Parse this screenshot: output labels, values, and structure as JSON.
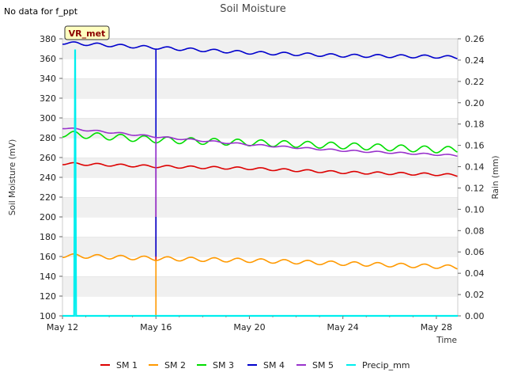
{
  "chart_data": {
    "type": "line",
    "title": "Soil Moisture",
    "no_data_note": "No data for f_ppt",
    "badge": "VR_met",
    "xlabel": "Time",
    "ylabel_left": "Soil Moisture (mV)",
    "ylabel_right": "Rain (mm)",
    "x_range": [
      "2023-05-12",
      "2023-05-28T22:00"
    ],
    "x_ticks": [
      "May 12",
      "May 16",
      "May 20",
      "May 24",
      "May 28"
    ],
    "y_left_range": [
      100,
      380
    ],
    "y_left_ticks": [
      "100",
      "120",
      "140",
      "160",
      "180",
      "200",
      "220",
      "240",
      "260",
      "280",
      "300",
      "320",
      "340",
      "360",
      "380"
    ],
    "y_right_range": [
      0.0,
      0.26
    ],
    "y_right_ticks": [
      "0.00",
      "0.02",
      "0.04",
      "0.06",
      "0.08",
      "0.10",
      "0.12",
      "0.14",
      "0.16",
      "0.18",
      "0.20",
      "0.22",
      "0.24",
      "0.26"
    ],
    "grid": "horizontal bands",
    "legend_position": "bottom",
    "series": [
      {
        "name": "SM 1",
        "color": "#dd0000",
        "axis": "left",
        "diurnal_amplitude": 1.2,
        "points": [
          [
            "May 12",
            254
          ],
          [
            "May 16",
            251
          ],
          [
            "May 20",
            249
          ],
          [
            "May 24",
            245
          ],
          [
            "May 28",
            243
          ],
          [
            "May 28 22:00",
            242
          ]
        ],
        "dropout": {
          "date": "May 16",
          "to": 155
        }
      },
      {
        "name": "SM 2",
        "color": "#ff9900",
        "axis": "left",
        "diurnal_amplitude": 2.0,
        "points": [
          [
            "May 12",
            161
          ],
          [
            "May 16",
            158
          ],
          [
            "May 20",
            156
          ],
          [
            "May 24",
            153
          ],
          [
            "May 28",
            150
          ],
          [
            "May 28 22:00",
            149
          ]
        ],
        "dropout": {
          "date": "May 16",
          "to": 100
        }
      },
      {
        "name": "SM 3",
        "color": "#00dd00",
        "axis": "left",
        "diurnal_amplitude": 3.2,
        "points": [
          [
            "May 12",
            284
          ],
          [
            "May 16",
            278
          ],
          [
            "May 20",
            275
          ],
          [
            "May 24",
            272
          ],
          [
            "May 28",
            268
          ],
          [
            "May 28 22:00",
            268
          ]
        ]
      },
      {
        "name": "SM 4",
        "color": "#0000cc",
        "axis": "left",
        "diurnal_amplitude": 1.5,
        "points": [
          [
            "May 12",
            376
          ],
          [
            "May 16",
            371
          ],
          [
            "May 20",
            366
          ],
          [
            "May 24",
            363
          ],
          [
            "May 28",
            362
          ],
          [
            "May 28 22:00",
            361
          ]
        ],
        "dropout": {
          "date": "May 16",
          "to": 160
        }
      },
      {
        "name": "SM 5",
        "color": "#9933cc",
        "axis": "left",
        "diurnal_amplitude": 0.8,
        "points": [
          [
            "May 12",
            290
          ],
          [
            "May 16",
            281
          ],
          [
            "May 20",
            273
          ],
          [
            "May 24",
            267
          ],
          [
            "May 28",
            263
          ],
          [
            "May 28 22:00",
            262
          ]
        ],
        "dropout": {
          "date": "May 16",
          "to": 200
        }
      },
      {
        "name": "Precip_mm",
        "color": "#00eeee",
        "axis": "right",
        "points": [
          [
            "May 12",
            0.0
          ],
          [
            "May 12 12:00",
            0.0
          ],
          [
            "May 12 13:00",
            0.25
          ],
          [
            "May 12 14:00",
            0.0
          ],
          [
            "May 28 22:00",
            0.0
          ]
        ]
      }
    ]
  }
}
